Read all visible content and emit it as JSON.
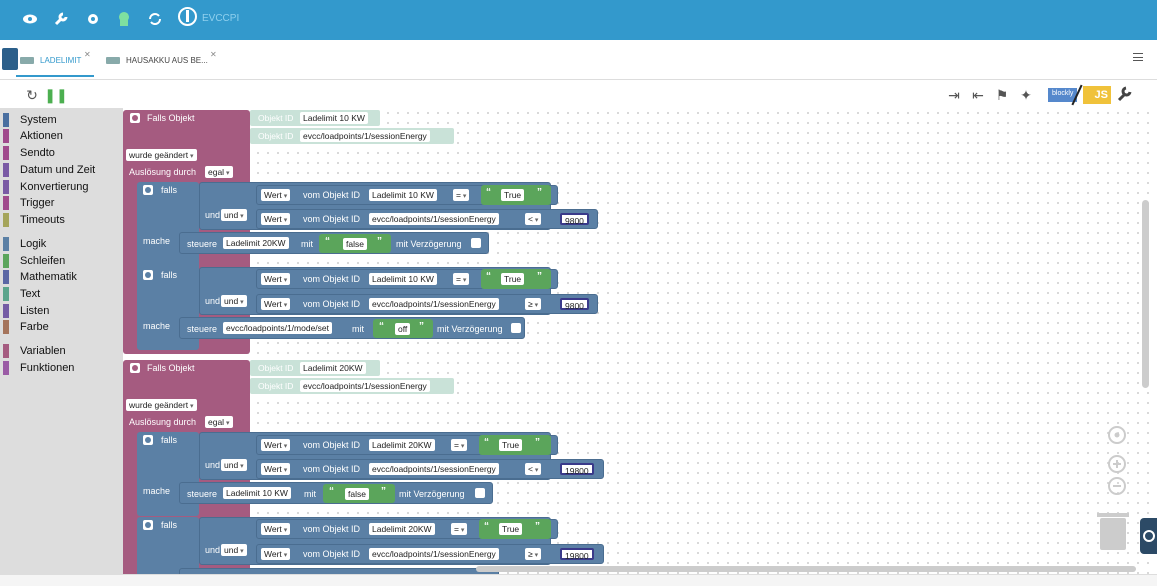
{
  "topbar": {
    "app_name": "EVCCPI",
    "icons": [
      "eye-icon",
      "wrench-icon",
      "gear-icon",
      "head-icon",
      "sync-icon"
    ]
  },
  "tabs": [
    {
      "label": "LADELIMIT",
      "active": true
    },
    {
      "label": "HAUSAKKU AUS BE...",
      "active": false
    }
  ],
  "toolbar": {
    "blockly": "blockly",
    "js": "JS"
  },
  "categories": [
    {
      "label": "System",
      "color": "#4a6fa0"
    },
    {
      "label": "Aktionen",
      "color": "#a04a8c"
    },
    {
      "label": "Sendto",
      "color": "#a04a8c"
    },
    {
      "label": "Datum und Zeit",
      "color": "#7a5aa5"
    },
    {
      "label": "Konvertierung",
      "color": "#7a5aa5"
    },
    {
      "label": "Trigger",
      "color": "#a04a8c"
    },
    {
      "label": "Timeouts",
      "color": "#a5a55b"
    },
    {
      "label": "Logik",
      "color": "#5b80a5"
    },
    {
      "label": "Schleifen",
      "color": "#5ba55b"
    },
    {
      "label": "Mathematik",
      "color": "#5b67a5"
    },
    {
      "label": "Text",
      "color": "#5ba58c"
    },
    {
      "label": "Listen",
      "color": "#745ba5"
    },
    {
      "label": "Farbe",
      "color": "#a5745b"
    },
    {
      "label": "Variablen",
      "color": "#a55b80"
    },
    {
      "label": "Funktionen",
      "color": "#9a5ba5"
    }
  ],
  "blocks": {
    "falls_objekt": "Falls Objekt",
    "objekt_id": "Objekt ID",
    "wurde_geaendert": "wurde geändert",
    "ausloesung": "Auslösung durch",
    "egal": "egal",
    "falls": "falls",
    "und": "und",
    "mache": "mache",
    "wert": "Wert",
    "vom_objekt_id": "vom Objekt ID",
    "steuere": "steuere",
    "mit": "mit",
    "mit_verzoegerung": "mit Verzögerung",
    "eq": "=",
    "lt": "<",
    "ge": "≥",
    "true": "True",
    "false": "false",
    "off": "off",
    "ladelimit10": "Ladelimit 10 KW",
    "ladelimit20": "Ladelimit 20KW",
    "session": "evcc/loadpoints/1/sessionEnergy",
    "modeset": "evcc/loadpoints/1/mode/set",
    "n9800": "9800",
    "n19800": "19800"
  }
}
